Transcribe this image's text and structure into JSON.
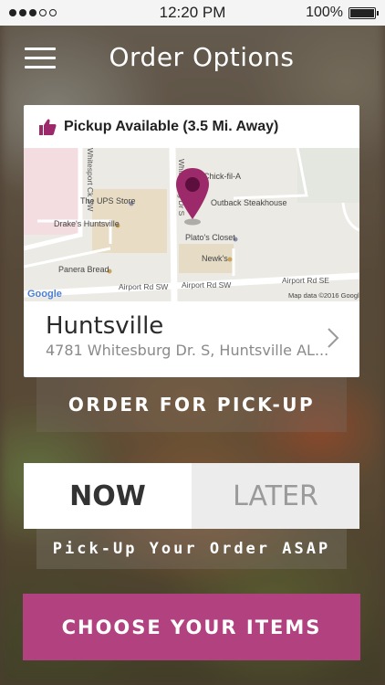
{
  "status_bar": {
    "time": "12:20 PM",
    "battery": "100%"
  },
  "header": {
    "title": "Order Options",
    "menu_icon": "hamburger-menu-icon"
  },
  "location": {
    "availability": "Pickup Available (3.5 Mi. Away)",
    "availability_icon": "thumbs-up-icon",
    "store_name": "Huntsville",
    "address": "4781 Whitesburg Dr. S, Huntsville AL...",
    "map": {
      "places": [
        "Chick-fil-A",
        "Outback Steakhouse",
        "The UPS Store",
        "Drake's Huntsville",
        "Plato's Closet",
        "Newk's",
        "Panera Bread"
      ],
      "roads": [
        "Whitesport Ck SW",
        "Whitesburg Dr S",
        "Airport Rd SW",
        "Airport Rd SE"
      ],
      "attribution_logo": "Google",
      "attribution_text": "Map data ©2016 Google"
    }
  },
  "buttons": {
    "order_pickup": "ORDER FOR PICK-UP",
    "choose_items": "CHOOSE YOUR ITEMS"
  },
  "timing": {
    "options": [
      "NOW",
      "LATER"
    ],
    "selected": "NOW",
    "message": "Pick-Up Your Order ASAP"
  },
  "colors": {
    "accent": "#b2417f",
    "pin": "#9c2a6a"
  }
}
